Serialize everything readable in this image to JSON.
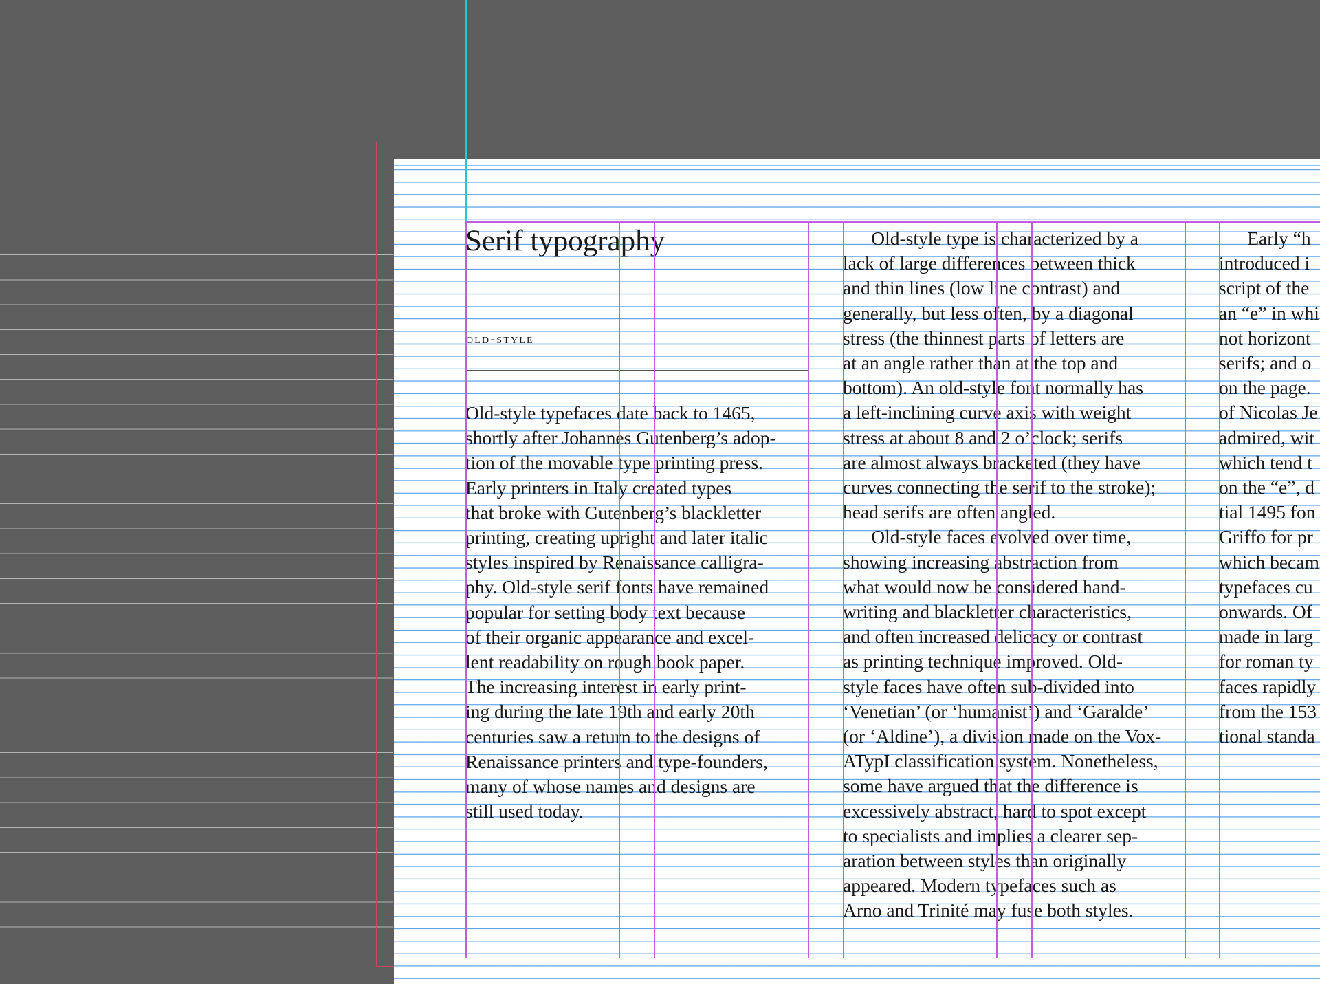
{
  "article": {
    "title": "Serif typography",
    "subhead": "OLD-STYLE",
    "column1": "Old-style typefaces date back to 1465,\nshortly after Johannes Gutenberg’s adop-\ntion of the movable type printing press.\nEarly printers in Italy created types\nthat broke with Gutenberg’s blackletter\nprinting, creating upright and later italic\nstyles inspired by Renaissance calligra-\nphy. Old-style serif fonts have remained\npopular for setting body text because\nof their organic appearance and excel-\nlent readability on rough book paper.\nThe increasing interest in early print-\ning during the late 19th and early 20th\ncenturies saw a return to the designs of\nRenaissance printers and type-founders,\nmany of whose names and designs are\nstill used today.",
    "column2": "      Old-style type is characterized by a\nlack of large differences between thick\nand thin lines (low line contrast) and\ngenerally, but less often, by a diagonal\nstress (the thinnest parts of letters are\nat an angle rather than at the top and\nbottom). An old-style font normally has\na left-inclining curve axis with weight\nstress at about 8 and 2 o’clock; serifs\nare almost always bracketed (they have\ncurves connecting the serif to the stroke);\nhead serifs are often angled.\n      Old-style faces evolved over time,\nshowing increasing abstraction from\nwhat would now be considered hand-\nwriting and blackletter characteristics,\nand often increased delicacy or contrast\nas printing technique improved. Old-\nstyle faces have often sub-divided into\n‘Venetian’ (or ‘humanist’) and ‘Garalde’\n(or ‘Aldine’), a division made on the Vox-\nATypI classification system. Nonetheless,\nsome have argued that the difference is\nexcessively abstract, hard to spot except\nto specialists and implies a clearer sep-\naration between styles than originally\nappeared. Modern typefaces such as\nArno and Trinité may fuse both styles.",
    "column3": "      Early “h\nintroduced i\nscript of the\nan “e” in whi\nnot horizont\nserifs; and o\non the page.\nof Nicolas Je\nadmired, wit\nwhich tend t\non the “e”, d\ntial 1495 fon\nGriffo for pr\nwhich becam\ntypefaces cu\nonwards. Of\nmade in larg\nfor roman ty\nfaces rapidly\nfrom the 153\ntional standa"
  },
  "colors": {
    "pasteboard": "#5e5e5e",
    "page": "#ffffff",
    "baseline_grid": "#4696e6",
    "column_guides": "#c25de0",
    "bleed_guide": "#c8465f",
    "ruler_guide": "#28c7d8"
  }
}
